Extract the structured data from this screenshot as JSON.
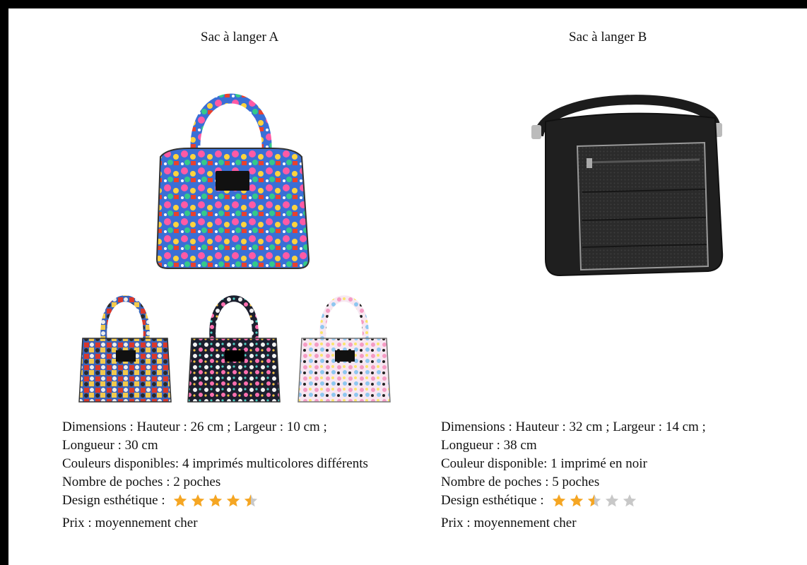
{
  "product_a": {
    "title": "Sac à langer A",
    "dimensions_line1": "Dimensions : Hauteur : 26 cm ; Largeur : 10 cm ;",
    "dimensions_line2": "Longueur : 30 cm",
    "colors": "Couleurs disponibles: 4 imprimés multicolores différents",
    "pockets": "Nombre de poches : 2 poches",
    "design_label": "Design esthétique :",
    "design_rating": 4.5,
    "price": "Prix : moyennement cher"
  },
  "product_b": {
    "title": "Sac à langer B",
    "dimensions_line1": "Dimensions : Hauteur : 32 cm ; Largeur : 14 cm ;",
    "dimensions_line2": "Longueur : 38 cm",
    "colors": "Couleur disponible: 1 imprimé en noir",
    "pockets": "Nombre de poches : 5 poches",
    "design_label": "Design esthétique :",
    "design_rating": 2.5,
    "price": "Prix : moyennement cher"
  },
  "colors": {
    "star_filled": "#f5a623",
    "star_empty": "#c8c8c8",
    "bag_b": "#222222"
  }
}
